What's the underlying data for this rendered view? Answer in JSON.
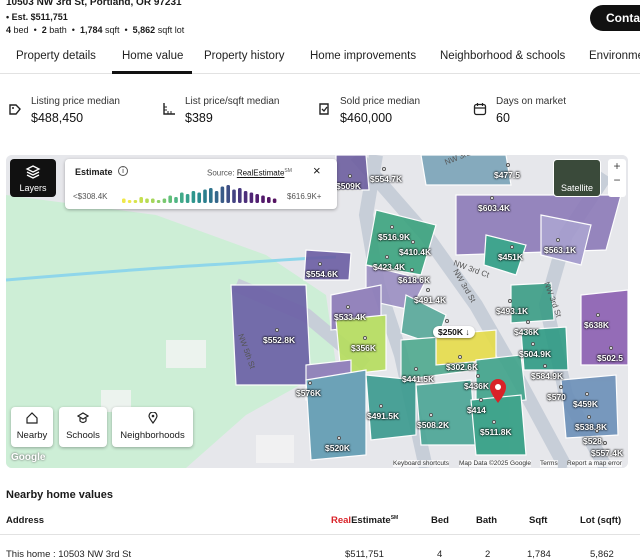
{
  "header": {
    "address": "10503 NW 3rd St, Portland, OR 97231",
    "estimate": "Est. $511,751",
    "beds": "4",
    "beds_label": "bed",
    "baths": "2",
    "baths_label": "bath",
    "sqft": "1,784",
    "sqft_label": "sqft",
    "lot": "5,862",
    "lot_label": "sqft lot",
    "contact_label": "Contact"
  },
  "tabs": [
    "Property details",
    "Home value",
    "Property history",
    "Home improvements",
    "Neighborhood & schools",
    "Environment"
  ],
  "active_tab": "Home value",
  "metrics": [
    {
      "label": "Listing price median",
      "value": "$488,450",
      "icon": "price-tag-icon"
    },
    {
      "label": "List price/sqft median",
      "value": "$389",
      "icon": "sqft-ruler-icon"
    },
    {
      "label": "Sold price median",
      "value": "$460,000",
      "icon": "sold-tag-icon"
    },
    {
      "label": "Days on market",
      "value": "60",
      "icon": "calendar-icon"
    }
  ],
  "map": {
    "layers_label": "Layers",
    "estimate_title": "Estimate",
    "source_prefix": "Source:",
    "source_name": "RealEstimate",
    "source_sup": "SM",
    "range_low": "<$308.4K",
    "range_high": "$616.9K+",
    "satellite_label": "Satellite",
    "zoom_in": "+",
    "zoom_out": "−",
    "buttons": [
      "Nearby",
      "Schools",
      "Neighborhoods"
    ],
    "google": "Google",
    "attribution": [
      "Keyboard shortcuts",
      "Map Data ©2025 Google",
      "Terms",
      "Report a map error"
    ],
    "streets": [
      "NW 3rd Ct",
      "NW 3rd St",
      "NW 3rd St",
      "NW 5th St",
      "NW 3rd St"
    ],
    "price_labels": [
      "$509K",
      "$554.7K",
      "$477.5",
      "$603.4K",
      "$516.9K",
      "$410.4K",
      "$423.4K",
      "$451K",
      "$563.1K",
      "$554.6K",
      "$618.6K",
      "$491.4K",
      "$533.4K",
      "$493.1K",
      "$638K",
      "$552.8K",
      "$356K",
      "$250K",
      "$436K",
      "$504.9K",
      "$302.6K",
      "$441.5K",
      "$502.5",
      "$436K",
      "$584.9K",
      "$576K",
      "$570",
      "$459K",
      "$491.5K",
      "$414",
      "$508.2K",
      "$538.8K",
      "$511.8K",
      "$528.",
      "$520K",
      "$557.4K"
    ],
    "colors": {
      "low": "#f0e84a",
      "mid": "#2aa889",
      "high": "#5b3f8f"
    }
  },
  "nearby": {
    "title": "Nearby home values",
    "columns": [
      "Address",
      "RealEstimate",
      "Bed",
      "Bath",
      "Sqft",
      "Lot (sqft)"
    ],
    "estimate_col_sup": "SM",
    "rows": [
      {
        "address": "This home : 10503 NW 3rd St",
        "estimate": "$511,751",
        "bed": "4",
        "bath": "2",
        "sqft": "1,784",
        "lot": "5,862"
      }
    ]
  }
}
